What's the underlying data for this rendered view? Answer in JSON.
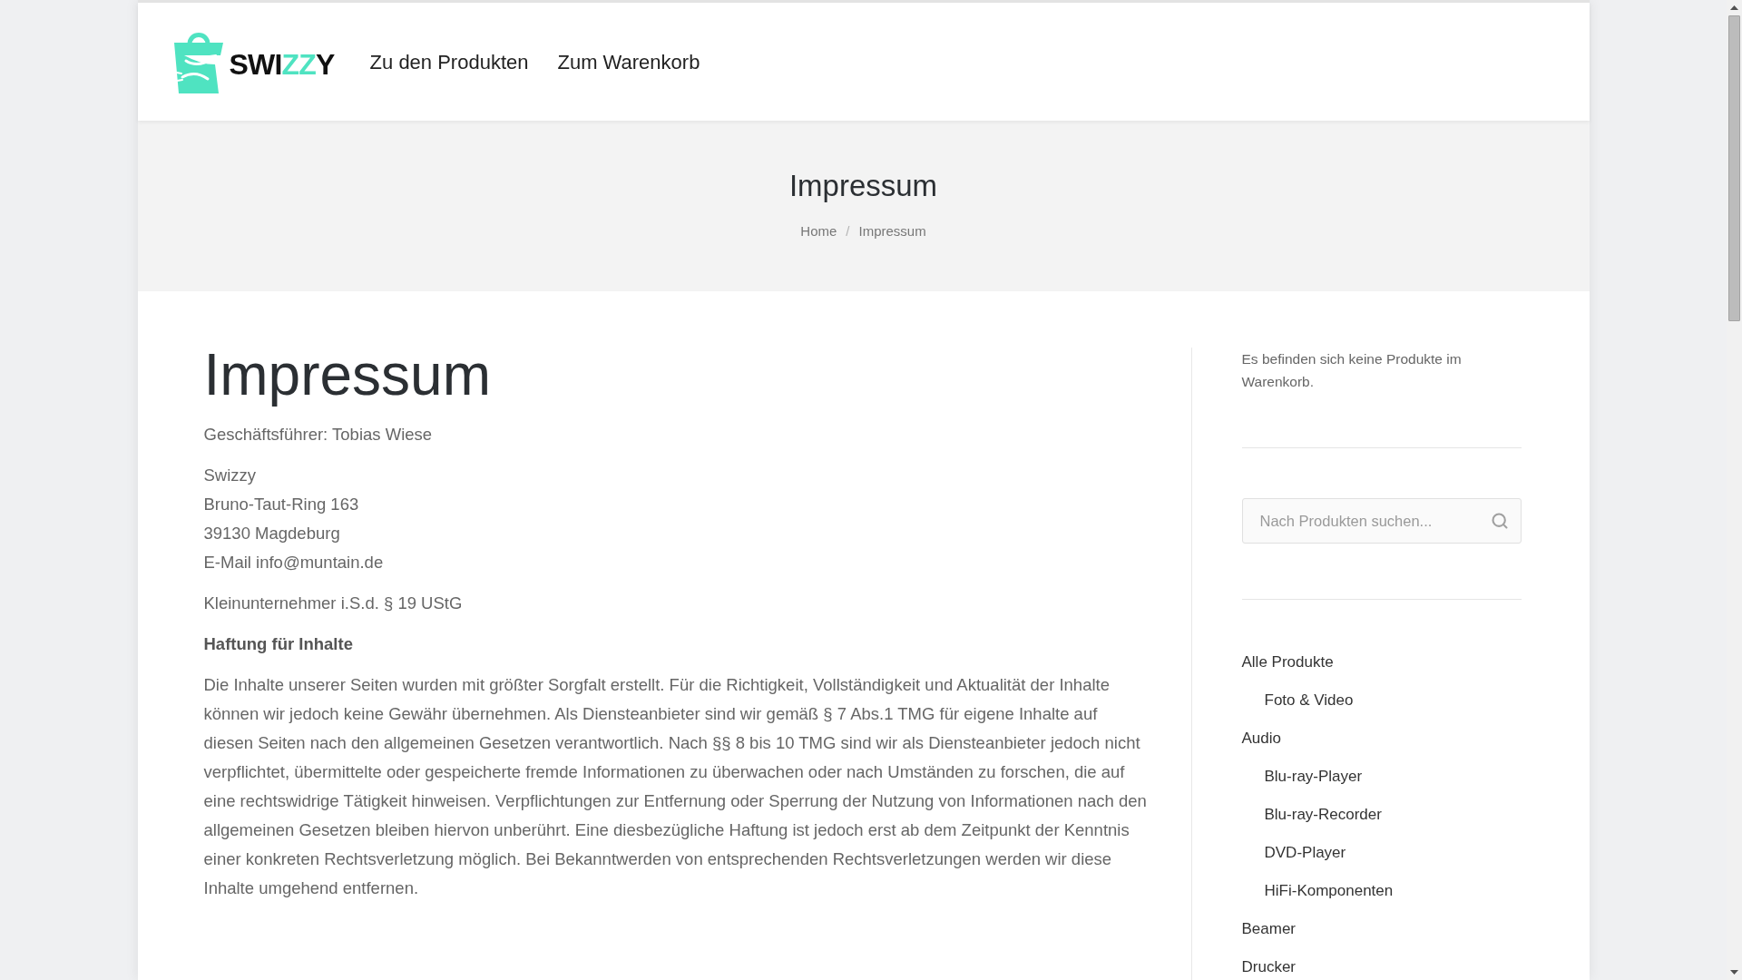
{
  "header": {
    "logo": {
      "wordmark": [
        {
          "text": "SWI",
          "accent": false
        },
        {
          "text": "ZZ",
          "accent": true
        },
        {
          "text": "Y",
          "accent": false
        }
      ]
    },
    "nav": [
      {
        "label": "Zu den Produkten"
      },
      {
        "label": "Zum Warenkorb"
      }
    ]
  },
  "title_band": {
    "title": "Impressum",
    "breadcrumb": [
      {
        "kind": "link",
        "label": "Home"
      },
      {
        "kind": "separator",
        "label": "/"
      },
      {
        "kind": "current",
        "label": "Impressum"
      }
    ]
  },
  "content": {
    "heading": "Impressum",
    "blocks": [
      {
        "kind": "paragraph",
        "text": "Geschäftsführer: Tobias Wiese"
      },
      {
        "kind": "address",
        "lines": [
          "Swizzy",
          "Bruno-Taut-Ring 163",
          "39130 Magdeburg",
          "E-Mail info@muntain.de"
        ]
      },
      {
        "kind": "paragraph",
        "text": "Kleinunternehmer i.S.d. § 19 UStG"
      },
      {
        "kind": "subheading",
        "text": "Haftung für Inhalte"
      },
      {
        "kind": "paragraph",
        "text": "Die Inhalte unserer Seiten wurden mit größter Sorgfalt erstellt. Für die Richtigkeit, Vollständigkeit und Aktualität der Inhalte können wir jedoch keine Gewähr übernehmen. Als Diensteanbieter sind wir gemäß § 7 Abs.1 TMG für eigene Inhalte auf diesen Seiten nach den allgemeinen Gesetzen verantwortlich. Nach §§ 8 bis 10 TMG sind wir als Diensteanbieter jedoch nicht verpflichtet, übermittelte oder gespeicherte fremde Informationen zu überwachen oder nach Umständen zu forschen, die auf eine rechtswidrige Tätigkeit hinweisen. Verpflichtungen zur Entfernung oder Sperrung der Nutzung von Informationen nach den allgemeinen Gesetzen bleiben hiervon unberührt. Eine diesbezügliche Haftung ist jedoch erst ab dem Zeitpunkt der Kenntnis einer konkreten Rechtsverletzung möglich. Bei Bekanntwerden von entsprechenden Rechtsverletzungen werden wir diese Inhalte umgehend entfernen."
      }
    ]
  },
  "sidebar": {
    "cart_message": "Es befinden sich keine Produkte im Warenkorb.",
    "search": {
      "placeholder": "Nach Produkten suchen..."
    },
    "categories": [
      {
        "label": "Alle Produkte",
        "children": [
          {
            "label": "Foto & Video"
          }
        ]
      },
      {
        "label": "Audio",
        "children": [
          {
            "label": "Blu-ray-Player"
          },
          {
            "label": "Blu-ray-Recorder"
          },
          {
            "label": "DVD-Player"
          },
          {
            "label": "HiFi-Komponenten"
          }
        ]
      },
      {
        "label": "Beamer"
      },
      {
        "label": "Drucker"
      }
    ]
  }
}
